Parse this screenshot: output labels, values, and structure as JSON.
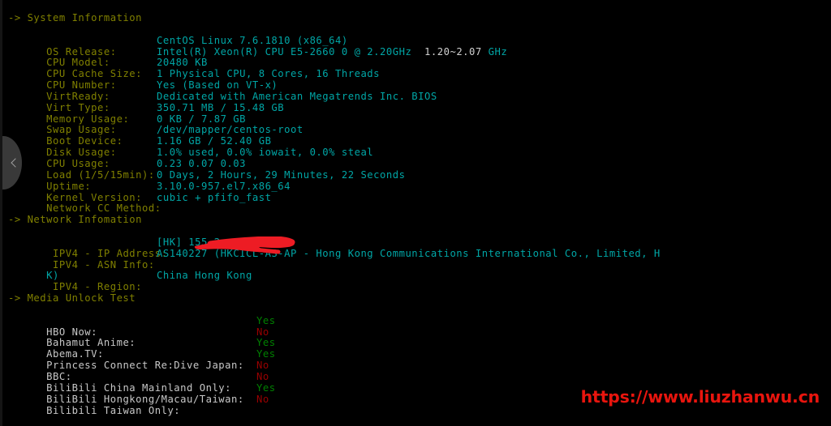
{
  "terminal": {
    "background": "#000000",
    "colors": {
      "section_header": "#808000",
      "label": "#808000",
      "value": "#00a6a6",
      "value_alt": "#d0d0d0",
      "yes": "#008000",
      "no": "#990000",
      "media_label": "#c8c8c8",
      "watermark": "#e8150e"
    }
  },
  "sections": {
    "system": {
      "header": "-> System Information",
      "rows": [
        {
          "label": "OS Release:",
          "value": "CentOS Linux 7.6.1810 (x86_64)"
        },
        {
          "label": "CPU Model:",
          "value": "Intel(R) Xeon(R) CPU E5-2660 0 @ 2.20GHz",
          "extra_white": "  1.20~2.07 ",
          "extra_value": "GHz"
        },
        {
          "label": "CPU Cache Size:",
          "value": "20480 KB"
        },
        {
          "label": "CPU Number:",
          "value": "1 Physical CPU, 8 Cores, 16 Threads"
        },
        {
          "label": "VirtReady:",
          "value": "Yes (Based on VT-x)"
        },
        {
          "label": "Virt Type:",
          "value": "Dedicated with American Megatrends Inc. BIOS"
        },
        {
          "label": "Memory Usage:",
          "value": "350.71 MB / 15.48 GB"
        },
        {
          "label": "Swap Usage:",
          "value": "0 KB / 7.87 GB"
        },
        {
          "label": "Boot Device:",
          "value": "/dev/mapper/centos-root"
        },
        {
          "label": "Disk Usage:",
          "value": "1.16 GB / 52.40 GB"
        },
        {
          "label": "CPU Usage:",
          "value": "1.0% used, 0.0% iowait, 0.0% steal"
        },
        {
          "label": "Load (1/5/15min):",
          "value": "0.23 0.07 0.03"
        },
        {
          "label": "Uptime:",
          "value": "0 Days, 2 Hours, 29 Minutes, 22 Seconds"
        },
        {
          "label": "Kernel Version:",
          "value": "3.10.0-957.el7.x86_64"
        },
        {
          "label": "Network CC Method:",
          "value": "cubic + pfifo_fast"
        }
      ]
    },
    "network": {
      "header": "-> Network Infomation",
      "rows": [
        {
          "label": " IPV4 - IP Address:",
          "value": "[HK] 155.2",
          "redacted": true
        },
        {
          "label": " IPV4 - ASN Info:",
          "value": "AS140227 (HKCICL-AS-AP - Hong Kong Communications International Co., Limited, H"
        },
        {
          "label": "",
          "value": "K)",
          "wrap": true
        },
        {
          "label": " IPV4 - Region:",
          "value": "China Hong Kong"
        }
      ]
    },
    "media": {
      "header": "-> Media Unlock Test",
      "rows": [
        {
          "label": "HBO Now:",
          "value": "Yes"
        },
        {
          "label": "Bahamut Anime:",
          "value": "No"
        },
        {
          "label": "Abema.TV:",
          "value": "Yes"
        },
        {
          "label": "Princess Connect Re:Dive Japan:",
          "value": "Yes"
        },
        {
          "label": "BBC:",
          "value": "No"
        },
        {
          "label": "BiliBili China Mainland Only:",
          "value": "No"
        },
        {
          "label": "BiliBili Hongkong/Macau/Taiwan:",
          "value": "Yes"
        },
        {
          "label": "Bilibili Taiwan Only:",
          "value": "No"
        }
      ]
    }
  },
  "overlays": {
    "back_gesture": "back-chevron",
    "redaction": "red-brush-stroke-over-ip"
  },
  "watermark": {
    "text": "https://www.liuzhanwu.cn"
  }
}
